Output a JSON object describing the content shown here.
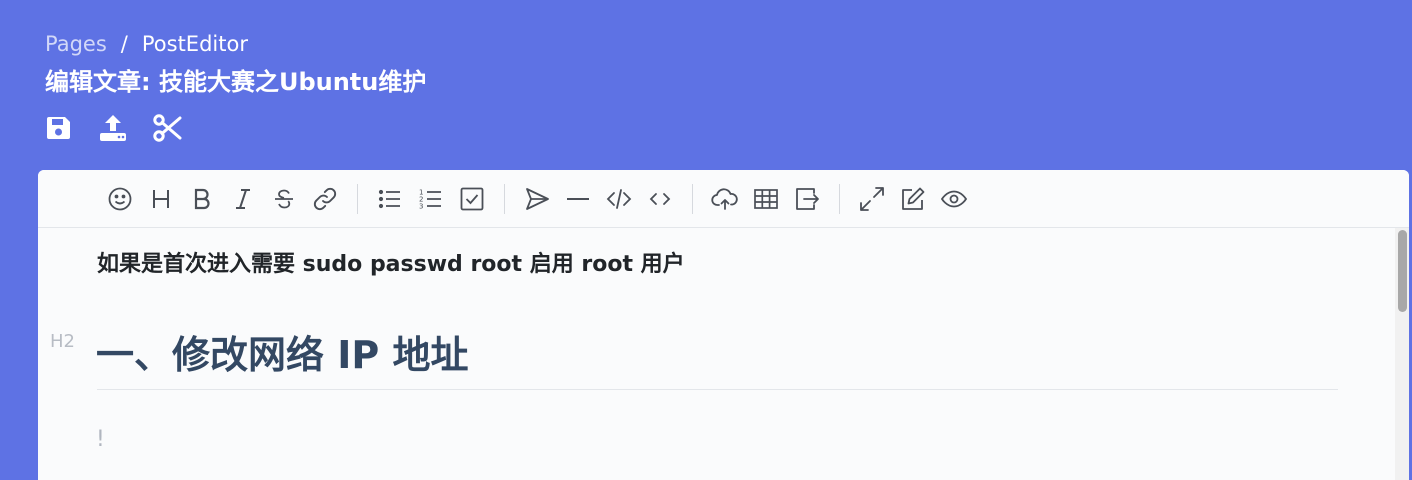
{
  "breadcrumb": {
    "parent": "Pages",
    "separator": "/",
    "current": "PostEditor"
  },
  "page": {
    "title": "编辑文章: 技能大赛之Ubuntu维护"
  },
  "actions": [
    {
      "icon": "save-icon"
    },
    {
      "icon": "upload-icon"
    },
    {
      "icon": "scissors-icon"
    }
  ],
  "toolbar": {
    "groups": [
      [
        "emoji-icon",
        "heading-icon",
        "bold-icon",
        "italic-icon",
        "strikethrough-icon",
        "link-icon"
      ],
      [
        "unordered-list-icon",
        "ordered-list-icon",
        "checkbox-icon"
      ],
      [
        "send-icon",
        "horizontal-rule-icon",
        "code-icon",
        "code-block-icon"
      ],
      [
        "upload-cloud-icon",
        "table-icon",
        "export-icon"
      ],
      [
        "fullscreen-icon",
        "edit-icon",
        "preview-icon"
      ]
    ],
    "heading_label": "H",
    "bold_label": "B",
    "italic_label": "I"
  },
  "content": {
    "note": "如果是首次进入需要 sudo passwd root 启用 root 用户",
    "heading_marker": "H2",
    "heading": "一、修改网络 IP 地址",
    "next_line": "!"
  },
  "colors": {
    "background": "#5e72e4",
    "editor_bg": "#fafbfc",
    "heading": "#334863"
  }
}
